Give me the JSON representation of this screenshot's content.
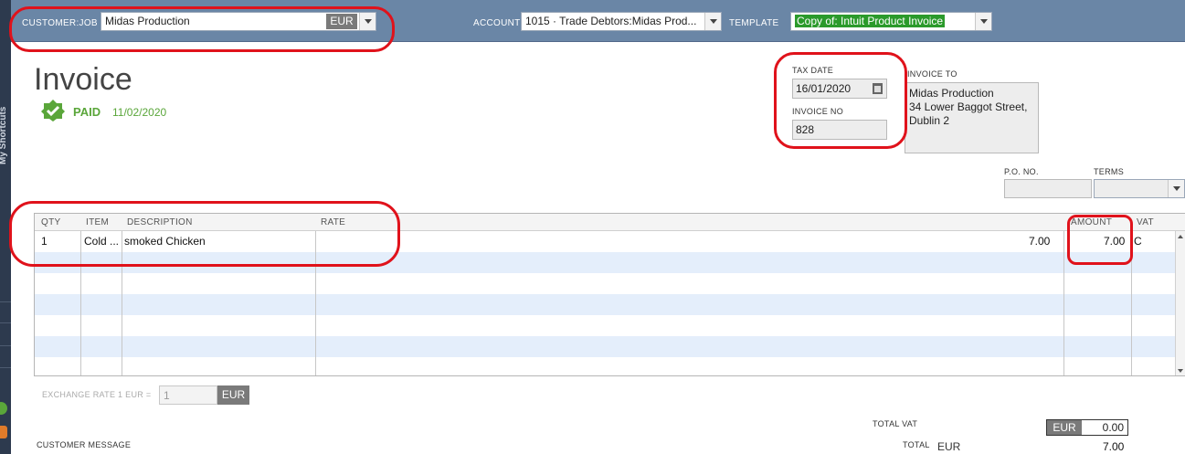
{
  "header": {
    "customer_job_label": "CUSTOMER:JOB",
    "customer_job_value": "Midas Production",
    "customer_currency": "EUR",
    "account_label": "ACCOUNT",
    "account_value": "1015 · Trade Debtors:Midas Prod...",
    "template_label": "TEMPLATE",
    "template_value": "Copy of: Intuit Product Invoice"
  },
  "invoice": {
    "title": "Invoice",
    "status": "PAID",
    "status_date": "11/02/2020",
    "tax_date_label": "TAX DATE",
    "tax_date": "16/01/2020",
    "invoice_no_label": "INVOICE NO",
    "invoice_no": "828",
    "invoice_to_label": "INVOICE TO",
    "invoice_to_lines": [
      "Midas Production",
      "34 Lower Baggot Street,",
      "Dublin 2"
    ],
    "po_no_label": "P.O. NO.",
    "po_no": "",
    "terms_label": "TERMS",
    "terms": ""
  },
  "table": {
    "columns": [
      "QTY",
      "ITEM",
      "DESCRIPTION",
      "RATE",
      "AMOUNT",
      "VAT"
    ],
    "rows": [
      {
        "qty": "1",
        "item": "Cold ...",
        "description": "smoked Chicken",
        "rate": "7.00",
        "amount": "7.00",
        "vat": "C"
      }
    ]
  },
  "exchange": {
    "label": "EXCHANGE RATE 1 EUR =",
    "value": "1",
    "currency": "EUR"
  },
  "footer": {
    "customer_message_label": "CUSTOMER MESSAGE",
    "total_vat_label": "TOTAL VAT",
    "total_vat_currency": "EUR",
    "total_vat_value": "0.00",
    "total_label": "TOTAL",
    "total_currency": "EUR",
    "total_value": "7.00"
  },
  "sidebar": {
    "vertical_label": "My Shortcuts"
  },
  "colors": {
    "header_bg": "#6a86a6",
    "paid_green": "#5aa63a",
    "annotation_red": "#e0121b",
    "row_alt": "#e4eefb"
  }
}
